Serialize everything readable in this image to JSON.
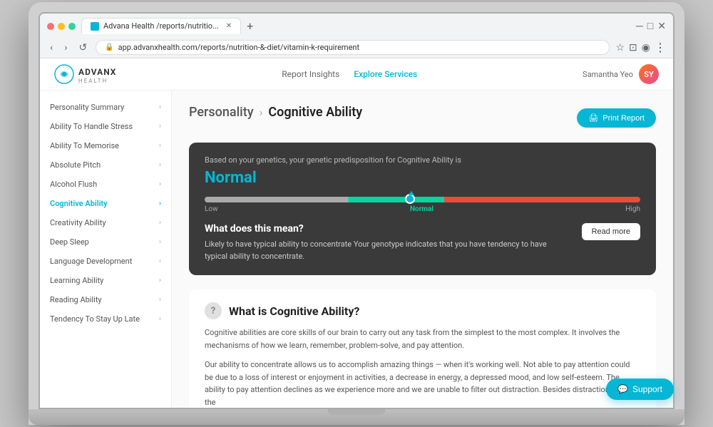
{
  "browser": {
    "tab_label": "Advana Health /reports/nutritio...",
    "url": "app.advanxhealth.com/reports/nutrition-&-diet/vitamin-k-requirement",
    "new_tab_label": "+"
  },
  "app": {
    "logo_text": "ADVANX",
    "logo_sub": "HEALTH",
    "nav_links": [
      {
        "label": "Report Insights",
        "active": false
      },
      {
        "label": "Explore Services",
        "active": true
      }
    ],
    "user_name": "Samantha Yeo",
    "user_initials": "SY"
  },
  "sidebar": {
    "items": [
      {
        "label": "Personality Summary",
        "active": false
      },
      {
        "label": "Ability To Handle Stress",
        "active": false
      },
      {
        "label": "Ability To Memorise",
        "active": false
      },
      {
        "label": "Absolute Pitch",
        "active": false
      },
      {
        "label": "Alcohol Flush",
        "active": false
      },
      {
        "label": "Cognitive Ability",
        "active": true
      },
      {
        "label": "Creativity Ability",
        "active": false
      },
      {
        "label": "Deep Sleep",
        "active": false
      },
      {
        "label": "Language Development",
        "active": false
      },
      {
        "label": "Learning Ability",
        "active": false
      },
      {
        "label": "Reading Ability",
        "active": false
      },
      {
        "label": "Tendency To Stay Up Late",
        "active": false
      }
    ]
  },
  "content": {
    "breadcrumb_parent": "Personality",
    "breadcrumb_sep": "›",
    "breadcrumb_current": "Cognitive Ability",
    "print_btn": "Print Report",
    "result_card": {
      "intro": "Based on your genetics, your genetic predisposition for Cognitive Ability is",
      "value": "Normal",
      "spectrum_labels": {
        "low": "Low",
        "normal": "Normal",
        "high": "High"
      },
      "meaning_title": "What does this mean?",
      "meaning_text": "Likely to have typical ability to concentrate Your genotype indicates that you have tendency to have typical ability to concentrate.",
      "read_more_btn": "Read more"
    },
    "info_section": {
      "title": "What is Cognitive Ability?",
      "para1": "Cognitive abilities are core skills of our brain to carry out any task from the simplest to the most complex. It involves the mechanisms of how we learn, remember, problem-solve, and pay attention.",
      "para2": "Our ability to concentrate allows us to accomplish amazing things — when it's working well. Not able to pay attention could be due to a loss of interest or enjoyment in activities, a decrease in energy, a depressed mood, and low self-esteem. The ability to pay attention declines as we experience more and we are unable to filter out distraction. Besides distraction from the"
    }
  },
  "support": {
    "label": "Support"
  }
}
